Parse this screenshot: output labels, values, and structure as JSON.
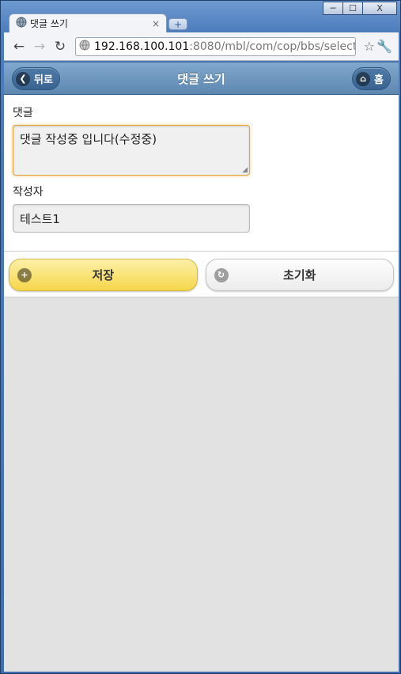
{
  "browser": {
    "tab_title": "댓글 쓰기",
    "tab_close": "×",
    "new_tab": "+",
    "url_host": "192.168.100.101",
    "url_path": ":8080/mbl/com/cop/bbs/selectE",
    "window_buttons": {
      "minimize": "─",
      "maximize": "☐",
      "close": "X"
    }
  },
  "header": {
    "title": "댓글 쓰기",
    "back_label": "뒤로",
    "home_label": "홈"
  },
  "form": {
    "comment_label": "댓글",
    "comment_value": "댓글 작성중 입니다(수정중)",
    "author_label": "작성자",
    "author_value": "테스트1"
  },
  "actions": {
    "save_label": "저장",
    "reset_label": "초기화"
  },
  "colors": {
    "header_blue": "#5e87b0",
    "save_yellow": "#f6d64a",
    "focus_orange": "#e1a63c"
  }
}
